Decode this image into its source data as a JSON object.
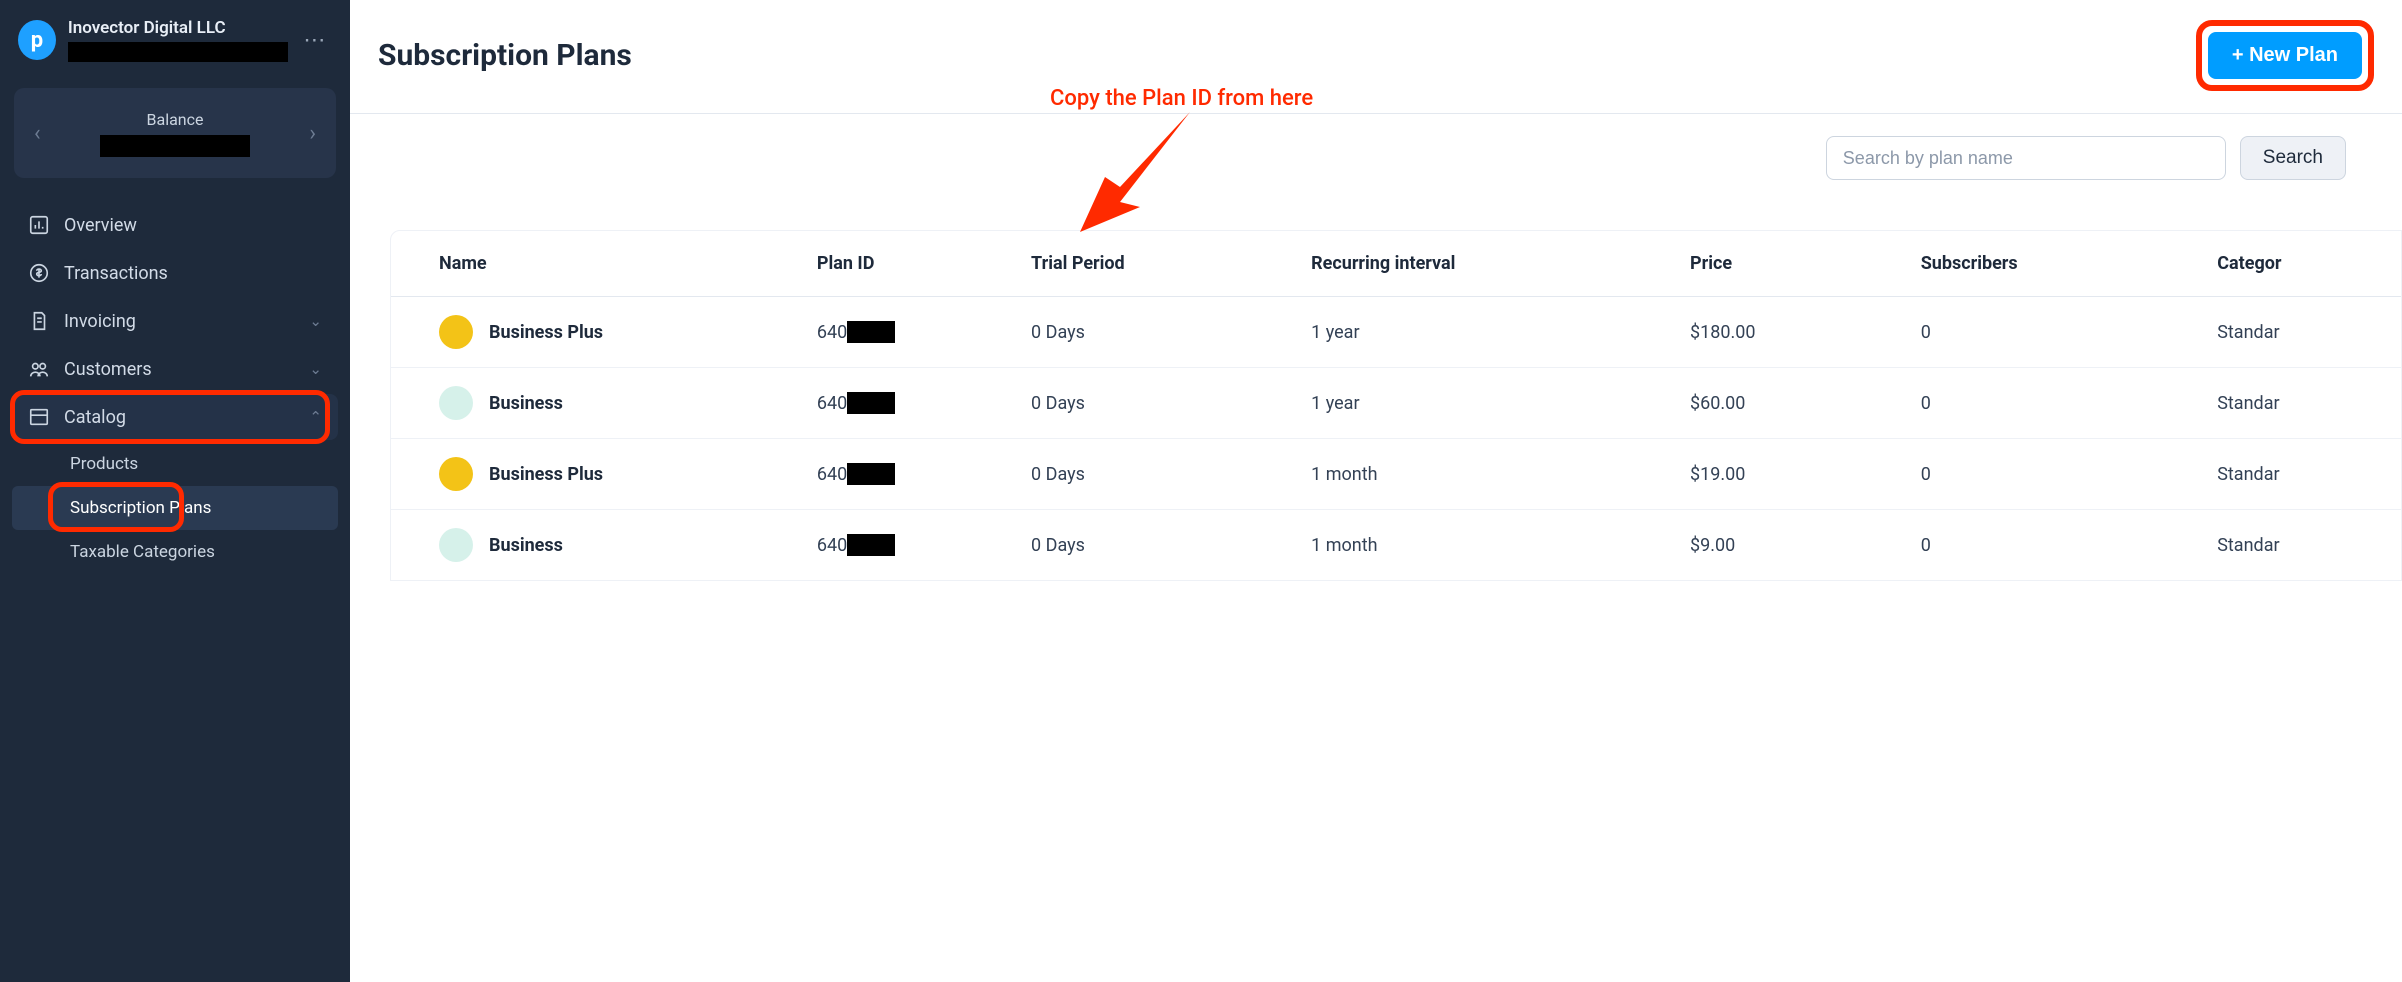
{
  "org": {
    "name": "Inovector Digital LLC"
  },
  "balance": {
    "label": "Balance"
  },
  "nav": {
    "overview": "Overview",
    "transactions": "Transactions",
    "invoicing": "Invoicing",
    "customers": "Customers",
    "catalog": "Catalog",
    "catalog_sub": {
      "products": "Products",
      "subscription_plans": "Subscription Plans",
      "taxable_categories": "Taxable Categories"
    }
  },
  "page": {
    "title": "Subscription Plans",
    "new_plan_btn": "+ New Plan",
    "search_placeholder": "Search by plan name",
    "search_btn": "Search"
  },
  "annotation": {
    "text": "Copy the Plan ID from here"
  },
  "table": {
    "headers": {
      "name": "Name",
      "plan_id": "Plan ID",
      "trial": "Trial Period",
      "interval": "Recurring interval",
      "price": "Price",
      "subscribers": "Subscribers",
      "category": "Categor"
    },
    "rows": [
      {
        "dot": "gold",
        "name": "Business Plus",
        "plan_id_prefix": "640",
        "trial": "0 Days",
        "interval": "1 year",
        "price": "$180.00",
        "subscribers": "0",
        "category": "Standar"
      },
      {
        "dot": "mint",
        "name": "Business",
        "plan_id_prefix": "640",
        "trial": "0 Days",
        "interval": "1 year",
        "price": "$60.00",
        "subscribers": "0",
        "category": "Standar"
      },
      {
        "dot": "gold",
        "name": "Business Plus",
        "plan_id_prefix": "640",
        "trial": "0 Days",
        "interval": "1 month",
        "price": "$19.00",
        "subscribers": "0",
        "category": "Standar"
      },
      {
        "dot": "mint",
        "name": "Business",
        "plan_id_prefix": "640",
        "trial": "0 Days",
        "interval": "1 month",
        "price": "$9.00",
        "subscribers": "0",
        "category": "Standar"
      }
    ]
  }
}
